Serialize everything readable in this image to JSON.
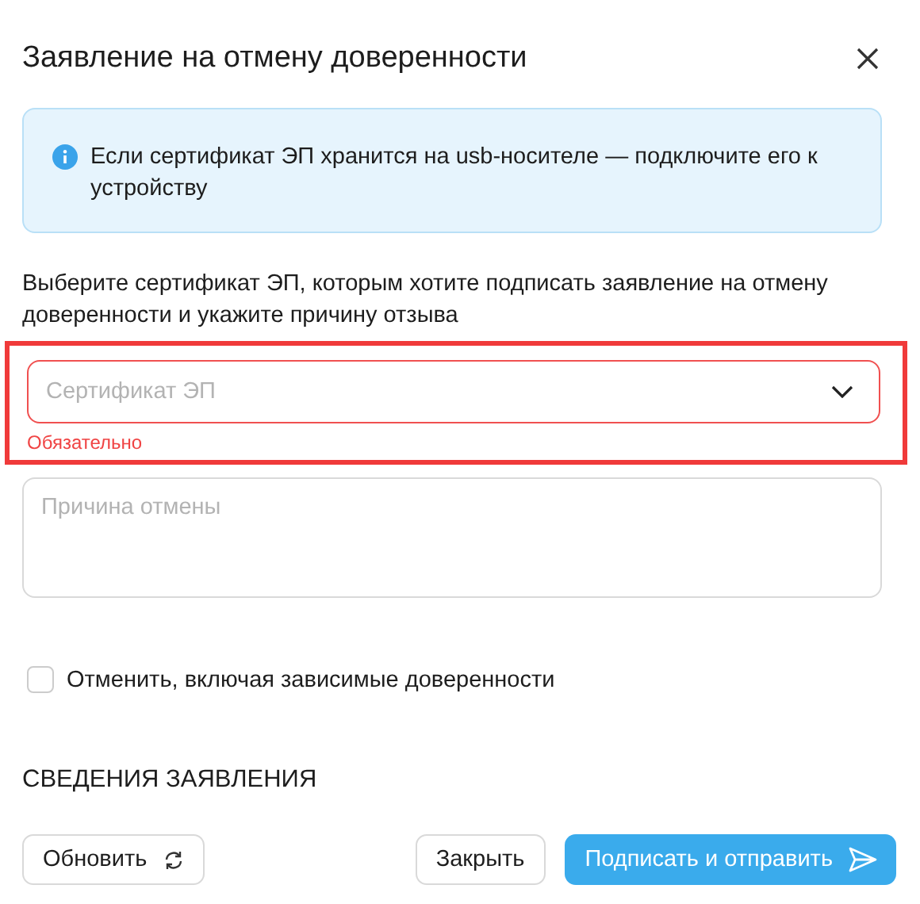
{
  "dialog": {
    "title": "Заявление на отмену доверенности"
  },
  "info": {
    "text": "Если сертификат ЭП хранится на usb-носителе — подключите его к устройству"
  },
  "instruction": "Выберите сертификат ЭП, которым хотите подписать заявление на отмену доверенности и укажите причину отзыва",
  "certificate_select": {
    "placeholder": "Сертификат ЭП",
    "error": true,
    "error_text": "Обязательно",
    "highlighted": true
  },
  "reason_field": {
    "placeholder": "Причина отмены"
  },
  "checkbox": {
    "label": "Отменить, включая зависимые доверенности",
    "checked": false
  },
  "section_title": "СВЕДЕНИЯ ЗАЯВЛЕНИЯ",
  "buttons": [
    {
      "label": "Обновить",
      "kind": "refresh"
    },
    {
      "label": "Закрыть",
      "kind": "secondary"
    },
    {
      "label": "Подписать и отправить",
      "kind": "primary"
    }
  ]
}
